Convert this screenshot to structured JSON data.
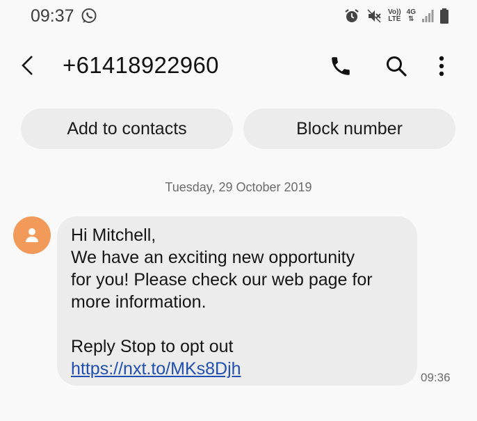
{
  "status_bar": {
    "time": "09:37",
    "icons": [
      "whatsapp-icon",
      "alarm-icon",
      "mute-icon",
      "volte-icon",
      "4g-icon",
      "signal-icon",
      "battery-icon"
    ],
    "volte_top": "Vo))",
    "volte_bottom": "LTE",
    "network": "4G"
  },
  "header": {
    "contact_number": "+61418922960",
    "icons": [
      "back-arrow-icon",
      "phone-icon",
      "search-icon",
      "more-vertical-icon"
    ]
  },
  "actions": {
    "add_to_contacts": "Add to contacts",
    "block_number": "Block number"
  },
  "conversation": {
    "date": "Tuesday, 29 October 2019",
    "message": {
      "lines": [
        "Hi Mitchell,",
        "We have an exciting new opportunity",
        "for you! Please check our web page for",
        "more information.",
        "",
        "Reply Stop to opt out"
      ],
      "link": "https://nxt.to/MKs8Djh",
      "time": "09:36"
    }
  },
  "colors": {
    "background": "#f9f9f9",
    "pill": "#ececec",
    "bubble": "#ececec",
    "avatar": "#f29a5a",
    "link": "#1f4fb0"
  }
}
